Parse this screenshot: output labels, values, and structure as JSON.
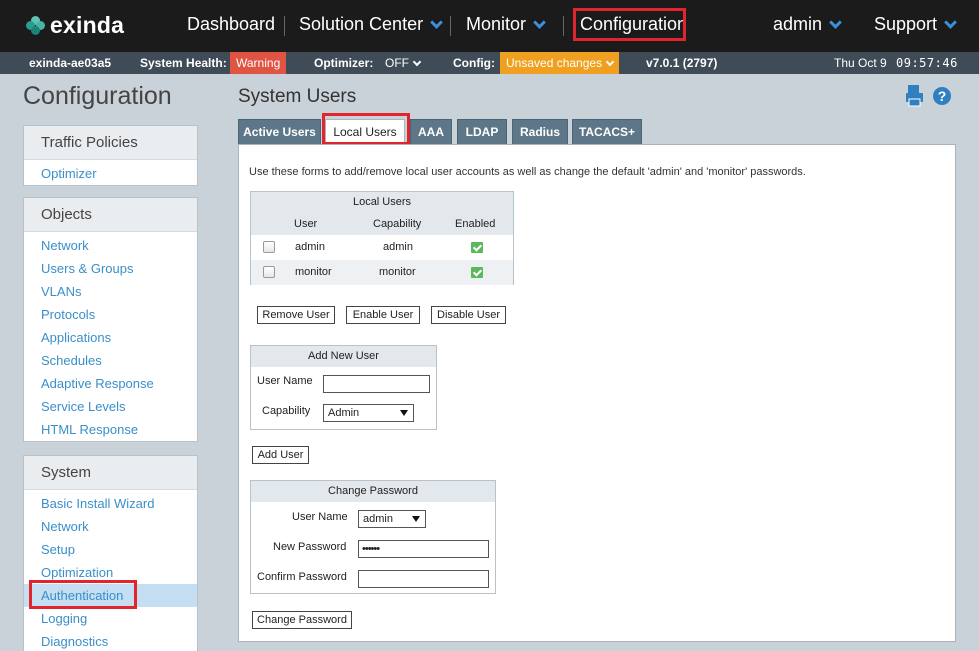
{
  "brand": {
    "name": "exinda"
  },
  "nav": {
    "dashboard": "Dashboard",
    "solution_center": "Solution Center",
    "monitor": "Monitor",
    "configuration": "Configuration",
    "user": "admin",
    "support": "Support"
  },
  "status": {
    "hostname": "exinda-ae03a5",
    "health_label": "System Health:",
    "health_value": "Warning",
    "optimizer_label": "Optimizer:",
    "optimizer_value": "OFF",
    "config_label": "Config:",
    "config_value": "Unsaved changes",
    "version": "v7.0.1 (2797)",
    "date": "Thu Oct 9",
    "time": "09:57:46"
  },
  "sidebar": {
    "title": "Configuration",
    "sections": [
      {
        "title": "Traffic Policies",
        "items": [
          "Optimizer"
        ]
      },
      {
        "title": "Objects",
        "items": [
          "Network",
          "Users & Groups",
          "VLANs",
          "Protocols",
          "Applications",
          "Schedules",
          "Adaptive Response",
          "Service Levels",
          "HTML Response"
        ]
      },
      {
        "title": "System",
        "items": [
          "Basic Install Wizard",
          "Network",
          "Setup",
          "Optimization",
          "Authentication",
          "Logging",
          "Diagnostics"
        ]
      }
    ]
  },
  "main": {
    "title": "System Users",
    "tabs": [
      "Active Users",
      "Local Users",
      "AAA",
      "LDAP",
      "Radius",
      "TACACS+"
    ],
    "active_tab": "Local Users",
    "description": "Use these forms to add/remove local user accounts as well as change the default 'admin' and 'monitor' passwords.",
    "local_users": {
      "title": "Local Users",
      "columns": [
        "User",
        "Capability",
        "Enabled"
      ],
      "rows": [
        {
          "user": "admin",
          "capability": "admin",
          "enabled": true
        },
        {
          "user": "monitor",
          "capability": "monitor",
          "enabled": true
        }
      ]
    },
    "actions": {
      "remove": "Remove User",
      "enable": "Enable User",
      "disable": "Disable User"
    },
    "add_user": {
      "title": "Add New User",
      "username_label": "User Name",
      "username_value": "",
      "capability_label": "Capability",
      "capability_value": "Admin",
      "button": "Add User"
    },
    "change_password": {
      "title": "Change Password",
      "username_label": "User Name",
      "username_value": "admin",
      "new_password_label": "New Password",
      "new_password_value": "••••••",
      "confirm_label": "Confirm Password",
      "confirm_value": "",
      "button": "Change Password"
    }
  },
  "colors": {
    "accent": "#3a8fc9",
    "highlight": "#e0252e",
    "warning": "#e05444",
    "unsaved": "#f0a020"
  }
}
